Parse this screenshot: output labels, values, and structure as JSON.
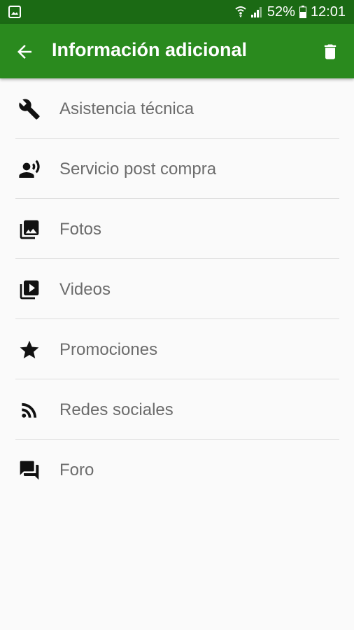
{
  "status_bar": {
    "battery": "52%",
    "time": "12:01"
  },
  "app_bar": {
    "title": "Información adicional",
    "back_icon": "arrow-back-icon",
    "action_icon": "trash-icon"
  },
  "colors": {
    "status_bar": "#1b6a14",
    "app_bar": "#2a8a1e",
    "background": "#fafafa",
    "label": "#6c6c6c",
    "icon": "#111111",
    "divider": "#dedede"
  },
  "menu": {
    "items": [
      {
        "label": "Asistencia técnica",
        "icon": "wrench-icon"
      },
      {
        "label": "Servicio post compra",
        "icon": "person-voice-icon"
      },
      {
        "label": "Fotos",
        "icon": "photo-library-icon"
      },
      {
        "label": "Videos",
        "icon": "video-library-icon"
      },
      {
        "label": "Promociones",
        "icon": "star-icon"
      },
      {
        "label": "Redes sociales",
        "icon": "rss-icon"
      },
      {
        "label": "Foro",
        "icon": "forum-icon"
      }
    ]
  }
}
